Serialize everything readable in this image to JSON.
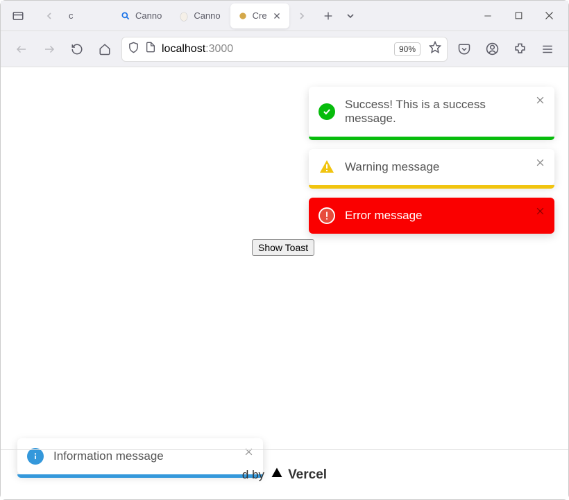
{
  "tabs": [
    {
      "label": "c"
    },
    {
      "label": "Canno"
    },
    {
      "label": "Canno"
    },
    {
      "label": "Cre"
    }
  ],
  "url": {
    "host": "localhost",
    "port": ":3000"
  },
  "zoom": "90%",
  "content": {
    "button_label": "Show Toast",
    "footer_text": "d by",
    "vercel": "Vercel"
  },
  "toasts": {
    "success": "Success! This is a success message.",
    "warning": "Warning message",
    "error": "Error message",
    "info": "Information message"
  },
  "colors": {
    "success": "#07bc0c",
    "warning": "#f1c40f",
    "error": "#fa0000",
    "info": "#3498db"
  }
}
